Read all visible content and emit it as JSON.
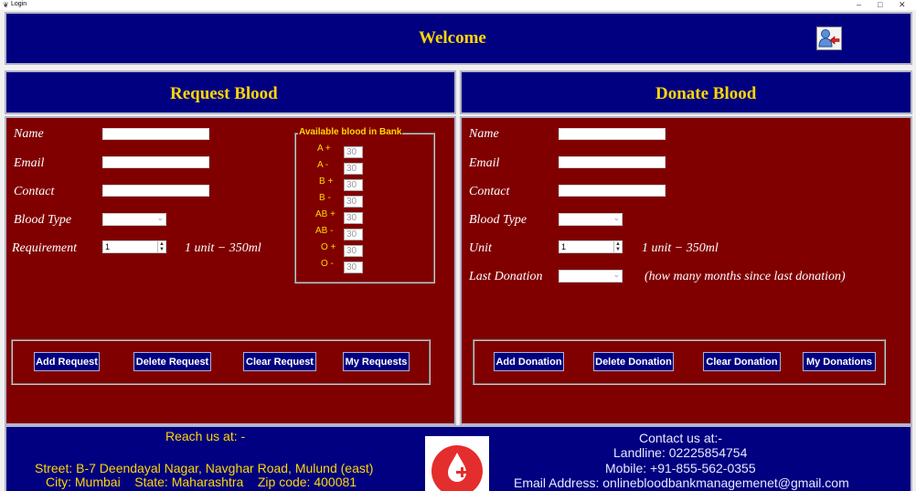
{
  "window": {
    "title": "Login"
  },
  "header": {
    "title": "Welcome",
    "logout_icon": "user-logout-icon"
  },
  "request": {
    "title": "Request Blood",
    "labels": {
      "name": "Name",
      "email": "Email",
      "contact": "Contact",
      "blood_type": "Blood Type",
      "requirement": "Requirement"
    },
    "requirement_value": "1",
    "unit_note": "1 unit − 350ml",
    "buttons": {
      "add": "Add Request",
      "delete": "Delete Request",
      "clear": "Clear Request",
      "mine": "My Requests"
    }
  },
  "available": {
    "title": "Available blood in Bank",
    "types": [
      {
        "type": "A +",
        "value": "30"
      },
      {
        "type": "A -",
        "value": "30"
      },
      {
        "type": "B +",
        "value": "30"
      },
      {
        "type": "B -",
        "value": "30"
      },
      {
        "type": "AB +",
        "value": "30"
      },
      {
        "type": "AB -",
        "value": "30"
      },
      {
        "type": "O +",
        "value": "30"
      },
      {
        "type": "O -",
        "value": "30"
      }
    ]
  },
  "donate": {
    "title": "Donate Blood",
    "labels": {
      "name": "Name",
      "email": "Email",
      "contact": "Contact",
      "blood_type": "Blood Type",
      "unit": "Unit",
      "last_donation": "Last Donation"
    },
    "unit_value": "1",
    "unit_note": "1 unit − 350ml",
    "last_donation_note": "(how many months since last donation)",
    "buttons": {
      "add": "Add Donation",
      "delete": "Delete Donation",
      "clear": "Clear Donation",
      "mine": "My Donations"
    }
  },
  "footer": {
    "reach_title": "Reach us at: -",
    "street": "Street: B-7 Deendayal Nagar, Navghar Road, Mulund (east)",
    "city_line": "City: Mumbai    State: Maharashtra    Zip code: 400081",
    "contact_title": "Contact us at:-",
    "landline": "Landline: 02225854754",
    "mobile": "Mobile: +91-855-562-0355",
    "email": "Email Address: onlinebloodbankmanagemenet@gmail.com",
    "logo_icon": "blood-drop-logo-icon"
  },
  "colors": {
    "header_bg": "#000080",
    "form_bg": "#800000",
    "title_text": "#ffd700"
  }
}
